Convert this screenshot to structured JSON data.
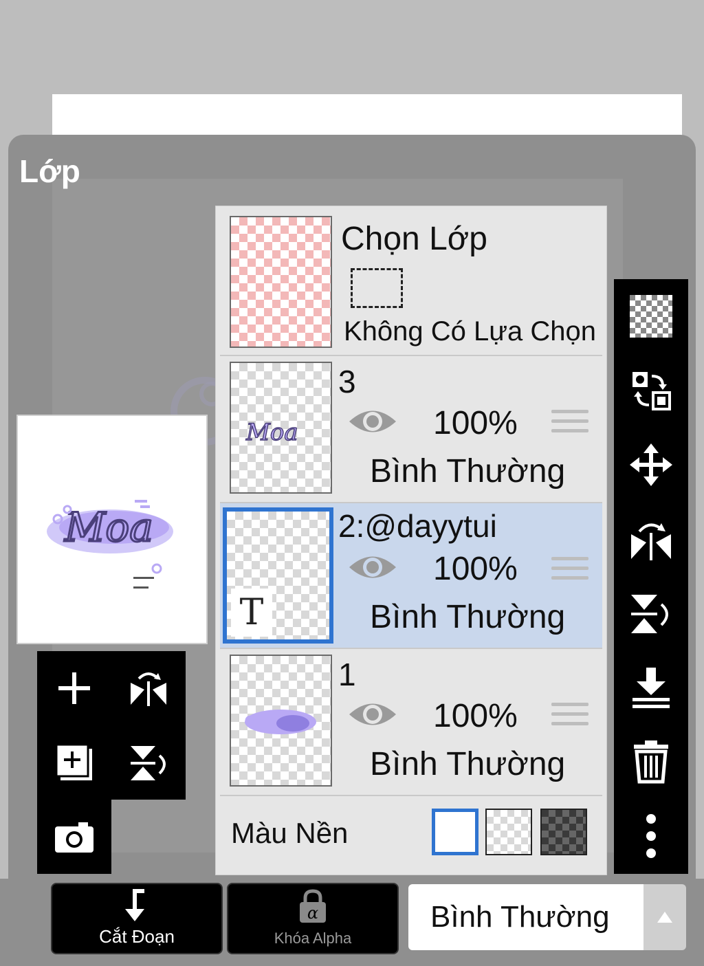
{
  "panel": {
    "title": "Lớp"
  },
  "selection": {
    "label": "Chọn Lớp",
    "status": "Không Có Lựa Chọn"
  },
  "layers": [
    {
      "name": "3",
      "opacity": "100%",
      "blend": "Bình Thường",
      "selected": false
    },
    {
      "name": "2:@dayytui",
      "opacity": "100%",
      "blend": "Bình Thường",
      "selected": true,
      "text_layer_glyph": "T"
    },
    {
      "name": "1",
      "opacity": "100%",
      "blend": "Bình Thường",
      "selected": false
    }
  ],
  "background": {
    "label": "Màu Nền",
    "options": [
      "white",
      "transparent",
      "dark-checker"
    ],
    "selected": "white"
  },
  "bottom": {
    "clip_label": "Cắt Đoạn",
    "alpha_lock_label": "Khóa Alpha",
    "alpha_symbol": "α",
    "blend_mode": "Bình Thường"
  },
  "preview": {
    "logo_text": "Moa"
  },
  "colors": {
    "accent": "#2f74d0",
    "selected_row": "#c9d7ec",
    "panel": "#8f8f8f",
    "logo": "#b9a9f5"
  }
}
